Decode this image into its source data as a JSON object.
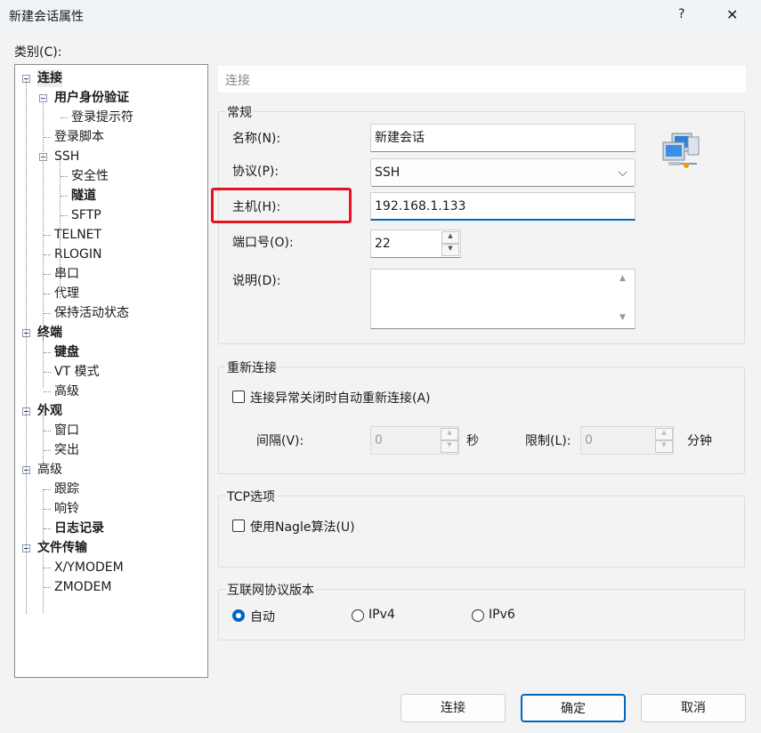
{
  "window": {
    "title": "新建会话属性",
    "help": "?",
    "close": "✕"
  },
  "category_label": "类别(C):",
  "tree": [
    {
      "label": "连接",
      "level": 0,
      "bold": true,
      "expander": true
    },
    {
      "label": "用户身份验证",
      "level": 1,
      "bold": true,
      "expander": true
    },
    {
      "label": "登录提示符",
      "level": 2
    },
    {
      "label": "登录脚本",
      "level": 1
    },
    {
      "label": "SSH",
      "level": 1,
      "expander": true
    },
    {
      "label": "安全性",
      "level": 2
    },
    {
      "label": "隧道",
      "level": 2,
      "bold": true
    },
    {
      "label": "SFTP",
      "level": 2
    },
    {
      "label": "TELNET",
      "level": 1
    },
    {
      "label": "RLOGIN",
      "level": 1
    },
    {
      "label": "串口",
      "level": 1
    },
    {
      "label": "代理",
      "level": 1
    },
    {
      "label": "保持活动状态",
      "level": 1
    },
    {
      "label": "终端",
      "level": 0,
      "bold": true,
      "expander": true
    },
    {
      "label": "键盘",
      "level": 1,
      "bold": true
    },
    {
      "label": "VT 模式",
      "level": 1
    },
    {
      "label": "高级",
      "level": 1
    },
    {
      "label": "外观",
      "level": 0,
      "bold": true,
      "expander": true
    },
    {
      "label": "窗口",
      "level": 1
    },
    {
      "label": "突出",
      "level": 1
    },
    {
      "label": "高级",
      "level": 0,
      "expander": true
    },
    {
      "label": "跟踪",
      "level": 1
    },
    {
      "label": "响铃",
      "level": 1
    },
    {
      "label": "日志记录",
      "level": 1,
      "bold": true
    },
    {
      "label": "文件传输",
      "level": 0,
      "bold": true,
      "expander": true
    },
    {
      "label": "X/YMODEM",
      "level": 1
    },
    {
      "label": "ZMODEM",
      "level": 1
    }
  ],
  "section_header": "连接",
  "general": {
    "title": "常规",
    "name_label": "名称(N):",
    "name_value": "新建会话",
    "protocol_label": "协议(P):",
    "protocol_value": "SSH",
    "host_label": "主机(H):",
    "host_value": "192.168.1.133",
    "port_label": "端口号(O):",
    "port_value": "22",
    "desc_label": "说明(D):",
    "desc_value": ""
  },
  "reconnect": {
    "title": "重新连接",
    "checkbox_label": "连接异常关闭时自动重新连接(A)",
    "interval_label": "间隔(V):",
    "interval_value": "0",
    "interval_unit": "秒",
    "limit_label": "限制(L):",
    "limit_value": "0",
    "limit_unit": "分钟"
  },
  "tcp": {
    "title": "TCP选项",
    "nagle_label": "使用Nagle算法(U)"
  },
  "ip": {
    "title": "互联网协议版本",
    "options": [
      "自动",
      "IPv4",
      "IPv6"
    ],
    "selected": "自动"
  },
  "buttons": {
    "connect": "连接",
    "ok": "确定",
    "cancel": "取消"
  },
  "colors": {
    "highlight": "#e81123",
    "accent": "#0067c0"
  }
}
